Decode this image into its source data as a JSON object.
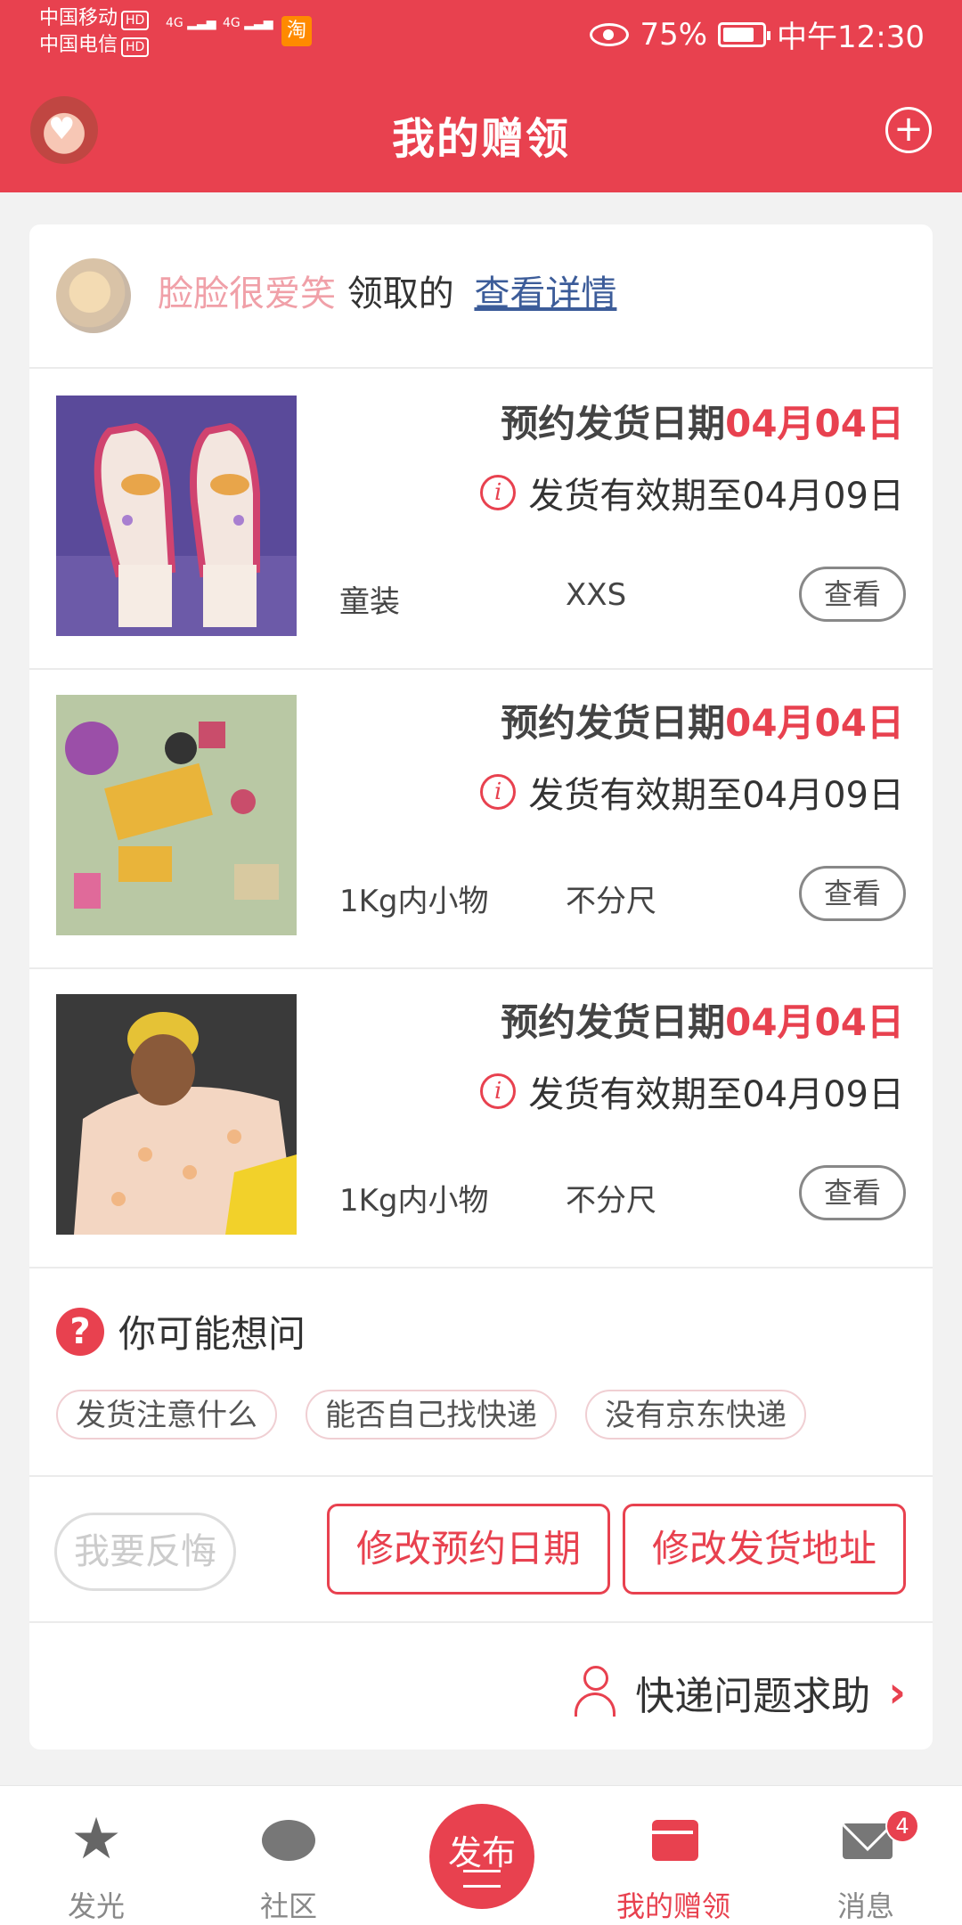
{
  "status_bar": {
    "carrier1": "中国移动",
    "carrier2": "中国电信",
    "hd": "HD",
    "net1": "4G",
    "net2": "4G",
    "taobao": "淘",
    "battery": "75%",
    "time": "中午12:30"
  },
  "header": {
    "title": "我的赠领",
    "plus": "+"
  },
  "claim": {
    "user": "脸脸很爱笑",
    "claimed_text": "领取的",
    "detail_link": "查看详情"
  },
  "items": [
    {
      "date_label": "预约发货日期",
      "date_value": "04月04日",
      "validity": "发货有效期至04月09日",
      "category": "童装",
      "size": "XXS",
      "view": "查看"
    },
    {
      "date_label": "预约发货日期",
      "date_value": "04月04日",
      "validity": "发货有效期至04月09日",
      "category": "1Kg内小物",
      "size": "不分尺",
      "view": "查看"
    },
    {
      "date_label": "预约发货日期",
      "date_value": "04月04日",
      "validity": "发货有效期至04月09日",
      "category": "1Kg内小物",
      "size": "不分尺",
      "view": "查看"
    }
  ],
  "faq": {
    "title": "你可能想问",
    "questions": [
      "发货注意什么",
      "能否自己找快递",
      "没有京东快递"
    ]
  },
  "actions": {
    "regret": "我要反悔",
    "change_date": "修改预约日期",
    "change_address": "修改发货地址"
  },
  "help": {
    "label": "快递问题求助"
  },
  "nav": {
    "items": [
      {
        "label": "发光"
      },
      {
        "label": "社区"
      },
      {
        "label": "发布"
      },
      {
        "label": "我的赠领"
      },
      {
        "label": "消息"
      }
    ],
    "message_badge": "4"
  },
  "colors": {
    "brand": "#e8414f",
    "link": "#3c5c99"
  }
}
